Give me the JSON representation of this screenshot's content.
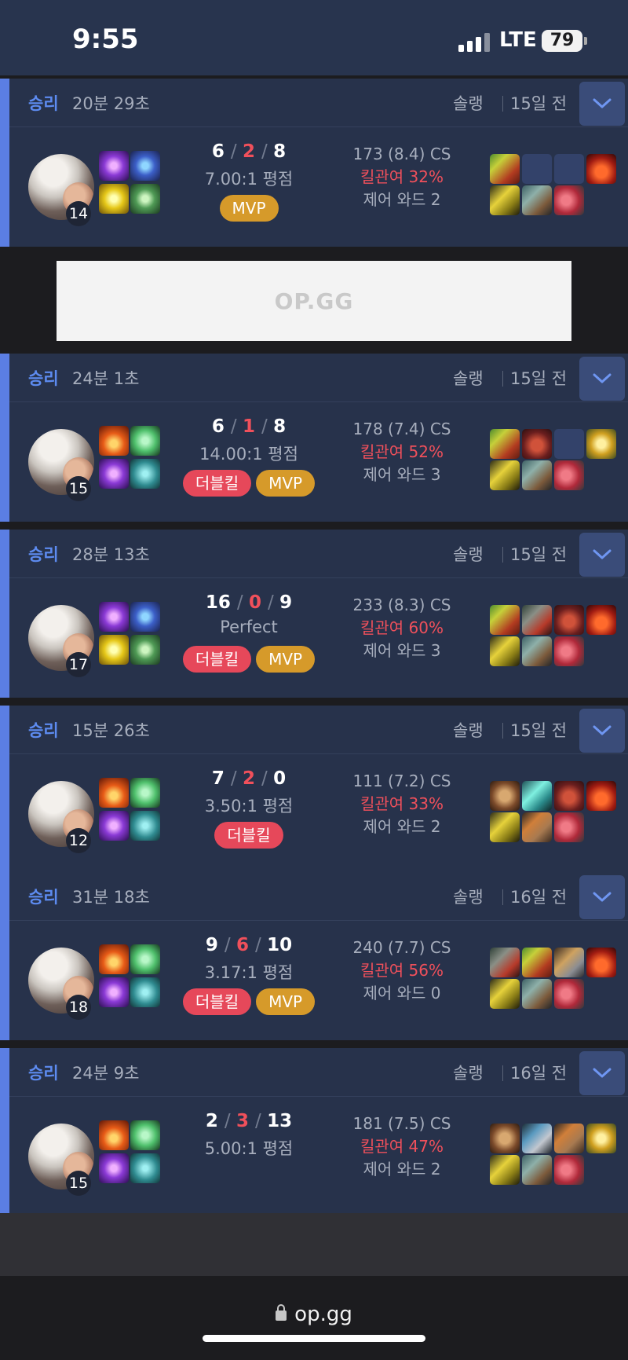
{
  "status_bar": {
    "time": "9:55",
    "network": "LTE",
    "battery": "79"
  },
  "ad": {
    "logo_text": "OP.GG"
  },
  "browser": {
    "url": "op.gg"
  },
  "matches": [
    {
      "result": "승리",
      "duration": "20분 29초",
      "queue": "솔랭",
      "ago": "15일 전",
      "level": "14",
      "spells": [
        "electrocute-icon",
        "mana-flowcharge-icon",
        "sorcery-rune-icon",
        "grasp-rune-icon"
      ],
      "kda": {
        "k": "6",
        "d": "2",
        "a": "8"
      },
      "ratio": "7.00:1 평점",
      "badges": [
        {
          "type": "mvp",
          "label": "MVP"
        }
      ],
      "cs": "173 (8.4) CS",
      "kill_participation": "킬관여 32%",
      "wards": "제어 와드 2",
      "items": [
        "hydra-item-icon",
        "empty-slot",
        "empty-slot",
        "sunfire-item-icon",
        "trinket-icon",
        "steelcaps-item-icon",
        "boots-item-icon"
      ]
    },
    {
      "result": "승리",
      "duration": "24분 1초",
      "queue": "솔랭",
      "ago": "15일 전",
      "level": "15",
      "spells": [
        "ignite-icon",
        "resolve-rune-icon",
        "electrocute-icon",
        "inspiration-rune-icon"
      ],
      "kda": {
        "k": "6",
        "d": "1",
        "a": "8"
      },
      "ratio": "14.00:1 평점",
      "badges": [
        {
          "type": "multi",
          "label": "더블킬"
        },
        {
          "type": "mvp",
          "label": "MVP"
        }
      ],
      "cs": "178 (7.4) CS",
      "kill_participation": "킬관여 52%",
      "wards": "제어 와드 3",
      "items": [
        "hydra-item-icon",
        "gauntlet-item-icon",
        "empty-slot",
        "gold-item-icon",
        "trinket-icon",
        "steelcaps-item-icon",
        "boots-item-icon"
      ]
    },
    {
      "result": "승리",
      "duration": "28분 13초",
      "queue": "솔랭",
      "ago": "15일 전",
      "level": "17",
      "spells": [
        "electrocute-icon",
        "mana-flowcharge-icon",
        "sorcery-rune-icon",
        "grasp-rune-icon"
      ],
      "kda": {
        "k": "16",
        "d": "0",
        "a": "9"
      },
      "ratio": "Perfect",
      "badges": [
        {
          "type": "multi",
          "label": "더블킬"
        },
        {
          "type": "mvp",
          "label": "MVP"
        }
      ],
      "cs": "233 (8.3) CS",
      "kill_participation": "킬관여 60%",
      "wards": "제어 와드 3",
      "items": [
        "hydra-item-icon",
        "maw-item-icon",
        "gauntlet-item-icon",
        "sunfire-item-icon",
        "trinket-icon",
        "steelcaps-item-icon",
        "boots-item-icon"
      ]
    },
    {
      "result": "승리",
      "duration": "15분 26초",
      "queue": "솔랭",
      "ago": "15일 전",
      "level": "12",
      "spells": [
        "ignite-icon",
        "resolve-rune-icon",
        "electrocute-icon",
        "inspiration-rune-icon"
      ],
      "kda": {
        "k": "7",
        "d": "2",
        "a": "0"
      },
      "ratio": "3.50:1 평점",
      "badges": [
        {
          "type": "multi",
          "label": "더블킬"
        }
      ],
      "cs": "111 (7.2) CS",
      "kill_participation": "킬관여 33%",
      "wards": "제어 와드 2",
      "items": [
        "shield-item-icon",
        "potion-item-icon",
        "gauntlet-item-icon",
        "sunfire-item-icon",
        "trinket-icon",
        "hammer-item-icon",
        "boots-item-icon"
      ]
    },
    {
      "result": "승리",
      "duration": "31분 18초",
      "queue": "솔랭",
      "ago": "16일 전",
      "level": "18",
      "spells": [
        "ignite-icon",
        "resolve-rune-icon",
        "electrocute-icon",
        "inspiration-rune-icon"
      ],
      "kda": {
        "k": "9",
        "d": "6",
        "a": "10"
      },
      "ratio": "3.17:1 평점",
      "badges": [
        {
          "type": "multi",
          "label": "더블킬"
        },
        {
          "type": "mvp",
          "label": "MVP"
        }
      ],
      "cs": "240 (7.7) CS",
      "kill_participation": "킬관여 56%",
      "wards": "제어 와드 0",
      "items": [
        "maw-item-icon",
        "hydra-item-icon",
        "blade-item-icon",
        "sunfire-item-icon",
        "trinket-icon",
        "steelcaps-item-icon",
        "boots-item-icon"
      ]
    },
    {
      "result": "승리",
      "duration": "24분 9초",
      "queue": "솔랭",
      "ago": "16일 전",
      "level": "15",
      "spells": [
        "ignite-icon",
        "resolve-rune-icon",
        "electrocute-icon",
        "inspiration-rune-icon"
      ],
      "kda": {
        "k": "2",
        "d": "3",
        "a": "13"
      },
      "ratio": "5.00:1 평점",
      "badges": [],
      "cs": "181 (7.5) CS",
      "kill_participation": "킬관여 47%",
      "wards": "제어 와드 2",
      "items": [
        "shield-item-icon",
        "pick-item-icon",
        "hammer-item-icon",
        "gold-item-icon",
        "trinket-icon",
        "steelcaps-item-icon",
        "boots-item-icon"
      ]
    }
  ]
}
